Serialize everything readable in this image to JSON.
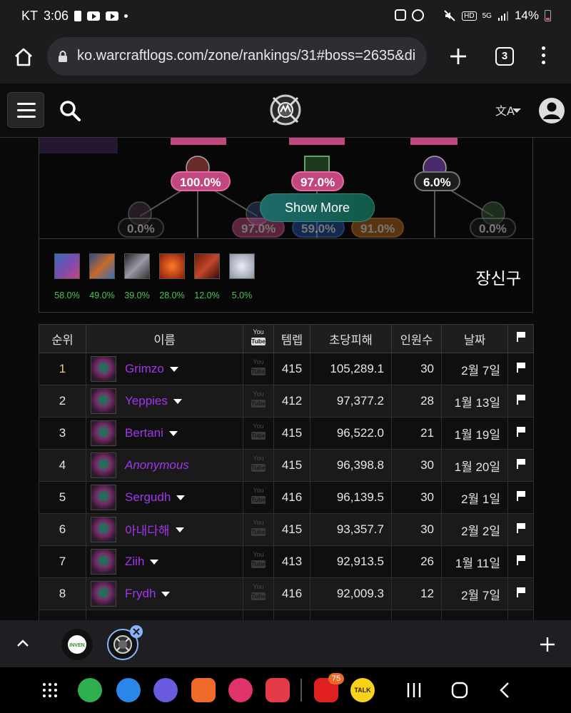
{
  "status_bar": {
    "carrier": "KT",
    "time": "3:06",
    "battery": "14%",
    "signal_label": "5G",
    "hd_label": "HD"
  },
  "browser": {
    "url": "ko.warcraftlogs.com/zone/rankings/31#boss=2635&di",
    "tab_count": "3"
  },
  "top_panel": {
    "percents_top": [
      "100.0%",
      "97.0%",
      "6.0%"
    ],
    "percents_bottom": [
      "0.0%",
      "97.0%",
      "59.0%",
      "91.0%",
      "0.0%"
    ],
    "show_more": "Show More",
    "spec_name": "장신구",
    "items": [
      {
        "name": "item-1",
        "pct": "58.0%",
        "color": "#7a4cb0"
      },
      {
        "name": "item-2",
        "pct": "49.0%",
        "color": "#3a6fb5"
      },
      {
        "name": "item-3",
        "pct": "39.0%",
        "color": "#9a9aa8"
      },
      {
        "name": "item-4",
        "pct": "28.0%",
        "color": "#c24a1e"
      },
      {
        "name": "item-5",
        "pct": "12.0%",
        "color": "#a4361e"
      },
      {
        "name": "item-6",
        "pct": "5.0%",
        "color": "#c8ccd4"
      }
    ]
  },
  "table": {
    "headers": {
      "rank": "순위",
      "name": "이름",
      "ilvl": "템렙",
      "dps": "초당피해",
      "size": "인원수",
      "date": "날짜"
    },
    "youtube_label": {
      "you": "You",
      "tube": "Tube"
    },
    "rows": [
      {
        "rank": "1",
        "name": "Grimzo",
        "ilvl": "415",
        "dps": "105,289.1",
        "size": "30",
        "date": "2월 7일"
      },
      {
        "rank": "2",
        "name": "Yeppies",
        "ilvl": "412",
        "dps": "97,377.2",
        "size": "28",
        "date": "1월 13일"
      },
      {
        "rank": "3",
        "name": "Bertani",
        "ilvl": "415",
        "dps": "96,522.0",
        "size": "21",
        "date": "1월 19일"
      },
      {
        "rank": "4",
        "name": "Anonymous",
        "ilvl": "415",
        "dps": "96,398.8",
        "size": "30",
        "date": "1월 20일"
      },
      {
        "rank": "5",
        "name": "Sergudh",
        "ilvl": "416",
        "dps": "96,139.5",
        "size": "30",
        "date": "2월 1일"
      },
      {
        "rank": "6",
        "name": "아내다해",
        "ilvl": "415",
        "dps": "93,357.7",
        "size": "30",
        "date": "2월 2일"
      },
      {
        "rank": "7",
        "name": "Ziih",
        "ilvl": "413",
        "dps": "92,913.5",
        "size": "26",
        "date": "1월 11일"
      },
      {
        "rank": "8",
        "name": "Frydh",
        "ilvl": "416",
        "dps": "92,009.3",
        "size": "12",
        "date": "2월 7일"
      }
    ]
  },
  "tabbar": {
    "inven_label": "INVEN"
  },
  "navbar": {
    "youtube_badge": "75",
    "talk_label": "TALK"
  },
  "colors": {
    "class_color": "#a335ee",
    "dps_color": "#9ff07c",
    "rank_color": "#e25c9a",
    "rank1_color": "#e5cc80"
  }
}
